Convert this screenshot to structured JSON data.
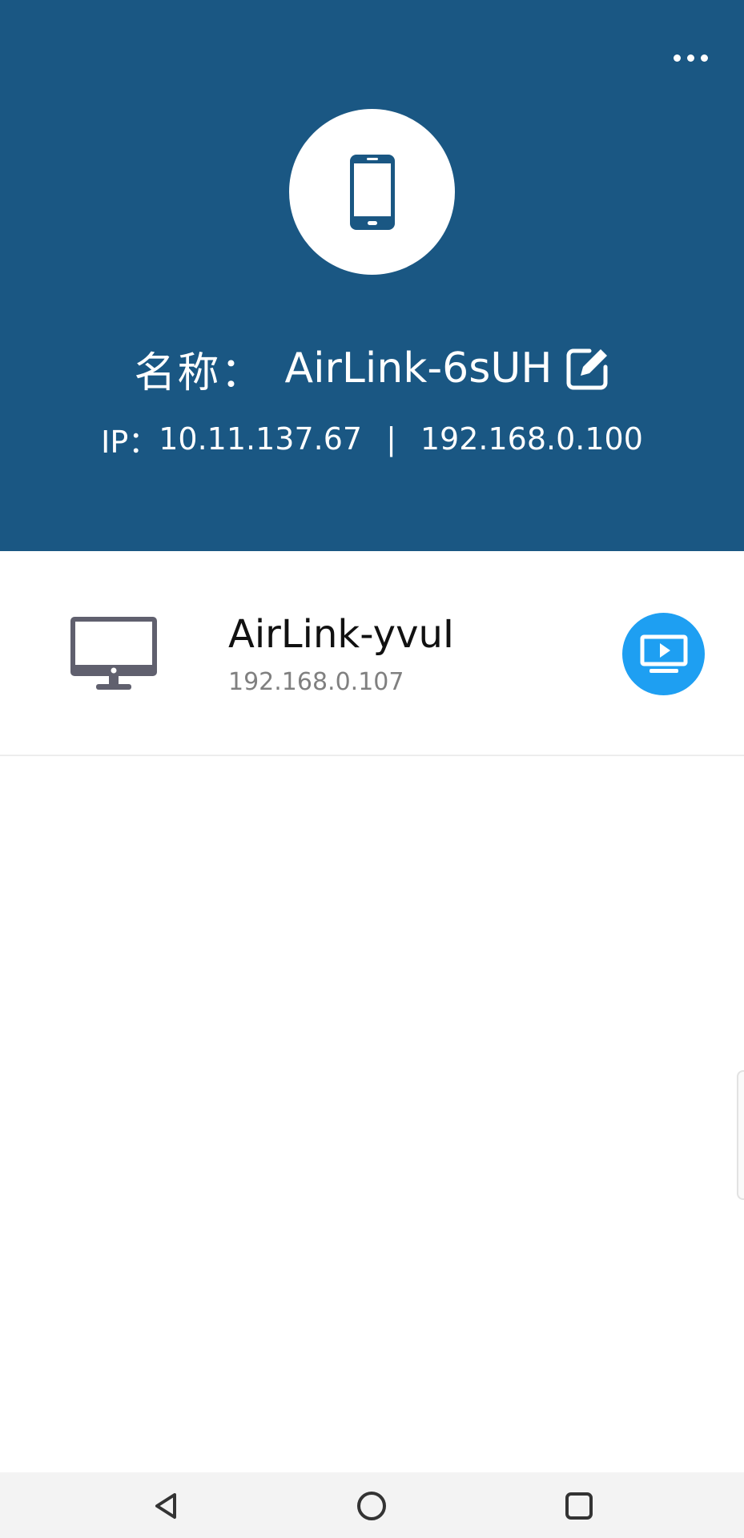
{
  "colors": {
    "header_bg": "#1a5783",
    "accent_blue": "#1e9ff2",
    "icon_gray": "#60606e"
  },
  "header": {
    "more_icon": "more-horizontal-icon",
    "device_icon": "smartphone-icon",
    "name_label": "名称：",
    "name_value": "AirLink-6sUH",
    "edit_icon": "edit-icon",
    "ip_label": "IP：",
    "ip_primary": "10.11.137.67",
    "ip_separator": "|",
    "ip_secondary": "192.168.0.100"
  },
  "devices": [
    {
      "icon": "desktop-monitor-icon",
      "name": "AirLink-yvuI",
      "ip": "192.168.0.107",
      "action_icon": "screen-cast-icon"
    }
  ],
  "navbar": {
    "back_icon": "back-triangle-icon",
    "home_icon": "home-circle-icon",
    "recents_icon": "recents-square-icon"
  }
}
